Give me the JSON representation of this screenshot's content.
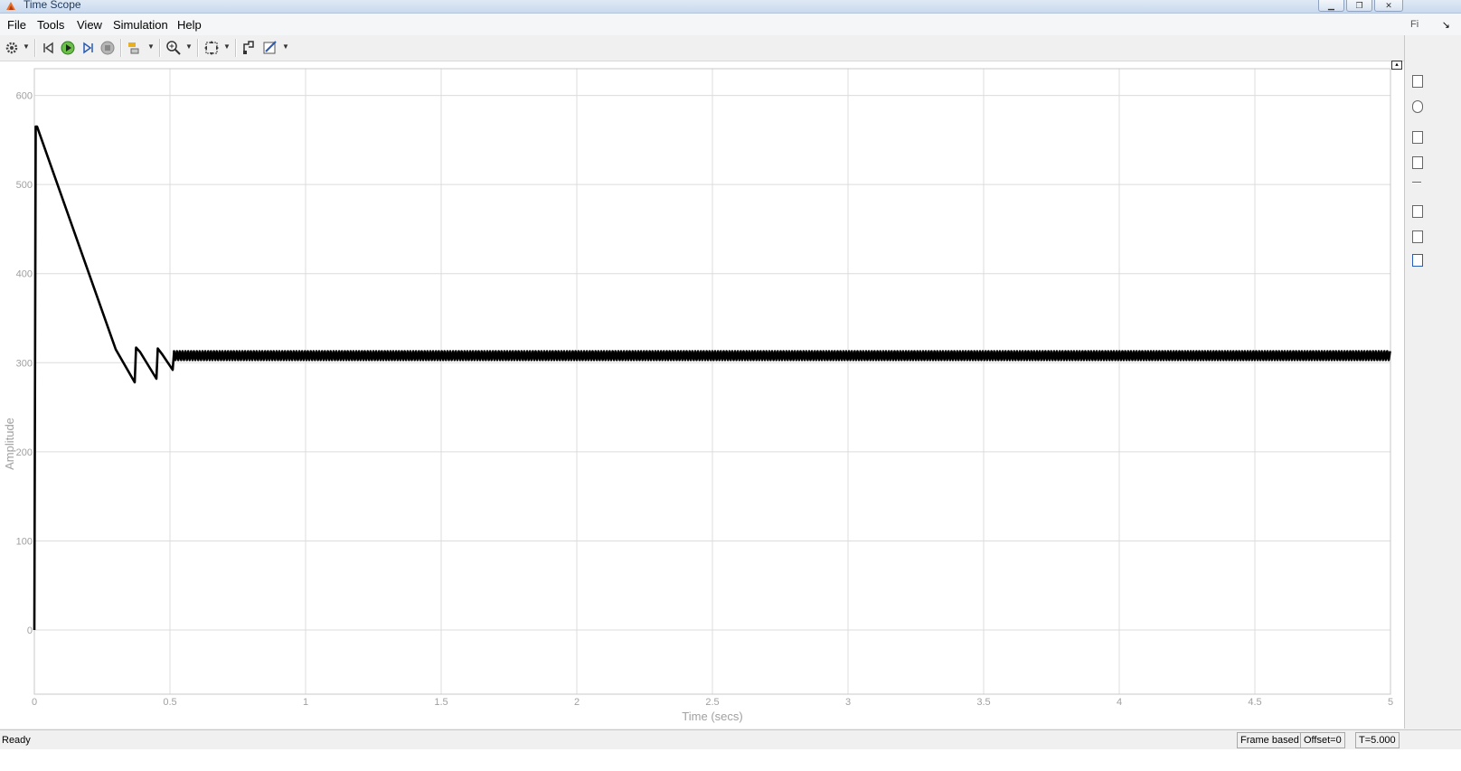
{
  "window": {
    "title": "Time Scope"
  },
  "menu": {
    "items": [
      "File",
      "Tools",
      "View",
      "Simulation",
      "Help"
    ]
  },
  "toolbar": {
    "icons": [
      "gear-icon",
      "step-back-icon",
      "run-icon",
      "step-forward-icon",
      "stop-icon",
      "signal-highlight-icon",
      "zoom-in-icon",
      "autoscale-icon",
      "data-cursor-icon",
      "measurements-icon"
    ]
  },
  "status": {
    "text": "Ready",
    "mode": "Frame based",
    "offset": "Offset=0",
    "time": "T=5.000"
  },
  "right_panel": {
    "label": "Fi"
  },
  "chart_data": {
    "type": "line",
    "title": "",
    "xlabel": "Time (secs)",
    "ylabel": "Amplitude",
    "xlim": [
      0,
      5
    ],
    "ylim": [
      -72,
      630
    ],
    "x_ticks": [
      "0",
      "0.5",
      "1",
      "1.5",
      "2",
      "2.5",
      "3",
      "3.5",
      "4",
      "4.5",
      "5"
    ],
    "y_ticks": [
      "0",
      "100",
      "200",
      "300",
      "400",
      "500",
      "600"
    ],
    "grid": true,
    "line_color": "#000000",
    "series": [
      {
        "x": [
          0,
          0.005,
          0.01,
          0.3,
          0.37,
          0.375,
          0.39,
          0.45,
          0.455,
          0.47,
          0.51,
          0.515,
          0.52,
          5
        ],
        "y": [
          0,
          565,
          565,
          315,
          278,
          317,
          312,
          282,
          316,
          310,
          292,
          312,
          308,
          308
        ],
        "ripple": {
          "from": 0.515,
          "to": 5,
          "center": 308,
          "amplitude": 5,
          "period": 0.0105
        }
      }
    ]
  }
}
